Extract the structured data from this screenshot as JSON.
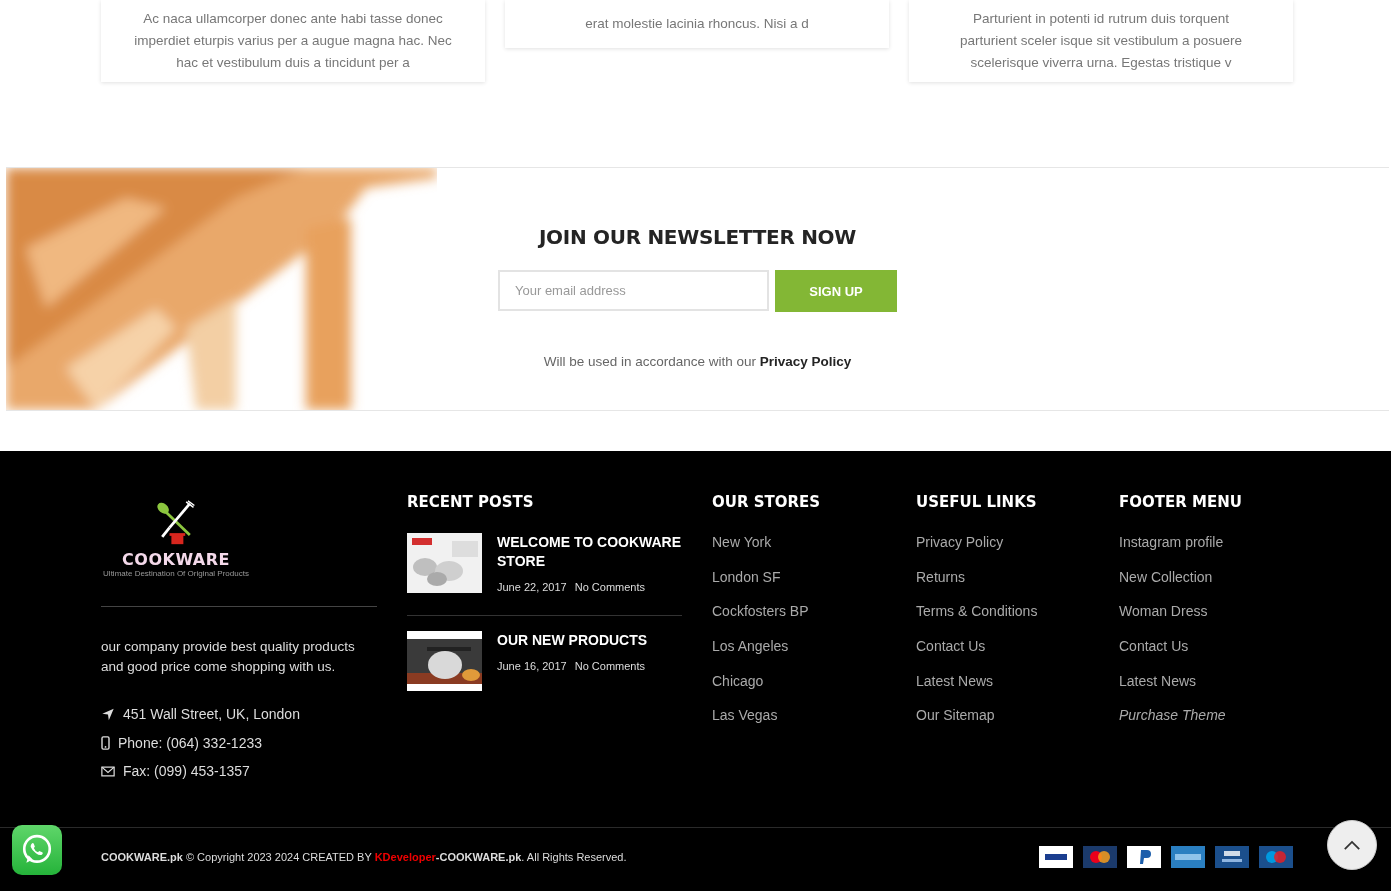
{
  "cards": [
    {
      "lines": [
        "Ac naca ullamcorper donec ante habi tasse donec",
        "imperdiet eturpis varius per a augue magna hac. Nec",
        "hac et vestibulum duis a tincidunt per a"
      ]
    },
    {
      "lines": [
        "erat molestie lacinia rhoncus. Nisi a d"
      ]
    },
    {
      "lines": [
        "Parturient in potenti id rutrum duis torquent",
        "parturient sceler isque sit vestibulum a posuere",
        "scelerisque viverra urna. Egestas tristique v"
      ]
    }
  ],
  "newsletter": {
    "title": "JOIN OUR NEWSLETTER NOW",
    "email": {
      "placeholder": "Your email address"
    },
    "button": "SIGN UP",
    "note": "Will be used in accordance with our",
    "note_link": "Privacy Policy"
  },
  "footer": {
    "logo": {
      "name": "COOKWARE",
      "tagline": "Ultimate Destination Of Original Products"
    },
    "description": "our company provide best quality products and good price come shopping with us.",
    "contacts": [
      {
        "kind": "address",
        "text": "451 Wall Street, UK, London"
      },
      {
        "kind": "phone",
        "text": "Phone: (064) 332-1233"
      },
      {
        "kind": "fax",
        "text": "Fax: (099) 453-1357"
      }
    ],
    "recent_posts": {
      "title": "RECENT POSTS",
      "posts": [
        {
          "title": "WELCOME TO COOKWARE STORE",
          "date": "June 22, 2017",
          "comments": "No Comments"
        },
        {
          "title": "OUR NEW PRODUCTS",
          "date": "June 16, 2017",
          "comments": "No Comments"
        }
      ]
    },
    "columns": [
      {
        "title": "OUR STORES",
        "links": [
          {
            "label": "New York",
            "italic": false
          },
          {
            "label": "London SF",
            "italic": false
          },
          {
            "label": "Cockfosters BP",
            "italic": false
          },
          {
            "label": "Los Angeles",
            "italic": false
          },
          {
            "label": "Chicago",
            "italic": false
          },
          {
            "label": "Las Vegas",
            "italic": false
          }
        ]
      },
      {
        "title": "USEFUL LINKS",
        "links": [
          {
            "label": "Privacy Policy",
            "italic": false
          },
          {
            "label": "Returns",
            "italic": false
          },
          {
            "label": "Terms & Conditions",
            "italic": false
          },
          {
            "label": "Contact Us",
            "italic": false
          },
          {
            "label": "Latest News",
            "italic": false
          },
          {
            "label": "Our Sitemap",
            "italic": false
          }
        ]
      },
      {
        "title": "FOOTER MENU",
        "links": [
          {
            "label": "Instagram profile",
            "italic": false
          },
          {
            "label": "New Collection",
            "italic": false
          },
          {
            "label": "Woman Dress",
            "italic": false
          },
          {
            "label": "Contact Us",
            "italic": false
          },
          {
            "label": "Latest News",
            "italic": false
          },
          {
            "label": "Purchase Theme",
            "italic": true
          }
        ]
      }
    ]
  },
  "copyright": {
    "before": "**COOKWARE.pk** © Copyright 2023 2024 CREATED BY",
    "author": "KDeveloper",
    "after": "**-COOKWARE.pk**. All Rights Reserved."
  },
  "payments": [
    {
      "kind": "visa"
    },
    {
      "kind": "mastercard"
    },
    {
      "kind": "paypal"
    },
    {
      "kind": "amex"
    },
    {
      "kind": "visa-electron"
    },
    {
      "kind": "maestro"
    }
  ]
}
